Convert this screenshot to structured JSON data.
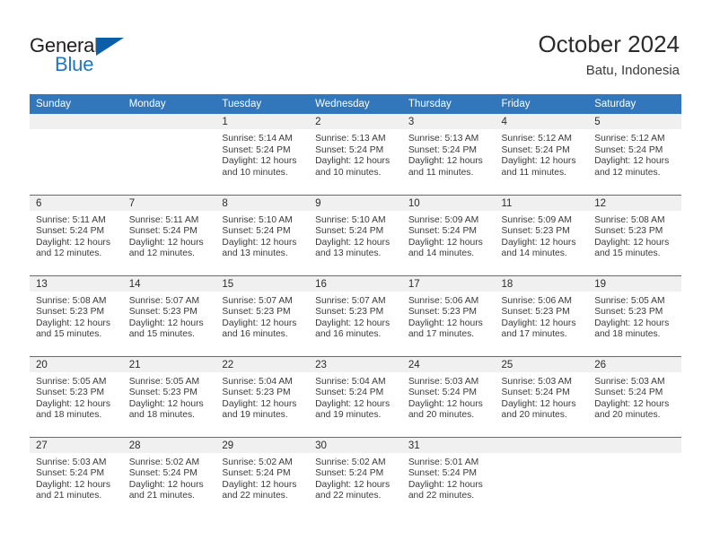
{
  "brand": {
    "name_part1": "General",
    "name_part2": "Blue",
    "triangle_color": "#0a5fa8",
    "blue_color": "#1f76c2"
  },
  "header": {
    "title": "October 2024",
    "subtitle": "Batu, Indonesia"
  },
  "theme": {
    "header_bg": "#3277bc",
    "daynum_bg": "#f0f0f0",
    "grid_line": "#3277bc",
    "text": "#3a3a3a"
  },
  "weekday_headers": [
    "Sunday",
    "Monday",
    "Tuesday",
    "Wednesday",
    "Thursday",
    "Friday",
    "Saturday"
  ],
  "weeks": [
    [
      {
        "day": "",
        "empty": true,
        "sunrise": "",
        "sunset": "",
        "daylight_1": "",
        "daylight_2": ""
      },
      {
        "day": "",
        "empty": true,
        "sunrise": "",
        "sunset": "",
        "daylight_1": "",
        "daylight_2": ""
      },
      {
        "day": "1",
        "empty": false,
        "sunrise": "Sunrise: 5:14 AM",
        "sunset": "Sunset: 5:24 PM",
        "daylight_1": "Daylight: 12 hours",
        "daylight_2": "and 10 minutes."
      },
      {
        "day": "2",
        "empty": false,
        "sunrise": "Sunrise: 5:13 AM",
        "sunset": "Sunset: 5:24 PM",
        "daylight_1": "Daylight: 12 hours",
        "daylight_2": "and 10 minutes."
      },
      {
        "day": "3",
        "empty": false,
        "sunrise": "Sunrise: 5:13 AM",
        "sunset": "Sunset: 5:24 PM",
        "daylight_1": "Daylight: 12 hours",
        "daylight_2": "and 11 minutes."
      },
      {
        "day": "4",
        "empty": false,
        "sunrise": "Sunrise: 5:12 AM",
        "sunset": "Sunset: 5:24 PM",
        "daylight_1": "Daylight: 12 hours",
        "daylight_2": "and 11 minutes."
      },
      {
        "day": "5",
        "empty": false,
        "sunrise": "Sunrise: 5:12 AM",
        "sunset": "Sunset: 5:24 PM",
        "daylight_1": "Daylight: 12 hours",
        "daylight_2": "and 12 minutes."
      }
    ],
    [
      {
        "day": "6",
        "empty": false,
        "sunrise": "Sunrise: 5:11 AM",
        "sunset": "Sunset: 5:24 PM",
        "daylight_1": "Daylight: 12 hours",
        "daylight_2": "and 12 minutes."
      },
      {
        "day": "7",
        "empty": false,
        "sunrise": "Sunrise: 5:11 AM",
        "sunset": "Sunset: 5:24 PM",
        "daylight_1": "Daylight: 12 hours",
        "daylight_2": "and 12 minutes."
      },
      {
        "day": "8",
        "empty": false,
        "sunrise": "Sunrise: 5:10 AM",
        "sunset": "Sunset: 5:24 PM",
        "daylight_1": "Daylight: 12 hours",
        "daylight_2": "and 13 minutes."
      },
      {
        "day": "9",
        "empty": false,
        "sunrise": "Sunrise: 5:10 AM",
        "sunset": "Sunset: 5:24 PM",
        "daylight_1": "Daylight: 12 hours",
        "daylight_2": "and 13 minutes."
      },
      {
        "day": "10",
        "empty": false,
        "sunrise": "Sunrise: 5:09 AM",
        "sunset": "Sunset: 5:24 PM",
        "daylight_1": "Daylight: 12 hours",
        "daylight_2": "and 14 minutes."
      },
      {
        "day": "11",
        "empty": false,
        "sunrise": "Sunrise: 5:09 AM",
        "sunset": "Sunset: 5:23 PM",
        "daylight_1": "Daylight: 12 hours",
        "daylight_2": "and 14 minutes."
      },
      {
        "day": "12",
        "empty": false,
        "sunrise": "Sunrise: 5:08 AM",
        "sunset": "Sunset: 5:23 PM",
        "daylight_1": "Daylight: 12 hours",
        "daylight_2": "and 15 minutes."
      }
    ],
    [
      {
        "day": "13",
        "empty": false,
        "sunrise": "Sunrise: 5:08 AM",
        "sunset": "Sunset: 5:23 PM",
        "daylight_1": "Daylight: 12 hours",
        "daylight_2": "and 15 minutes."
      },
      {
        "day": "14",
        "empty": false,
        "sunrise": "Sunrise: 5:07 AM",
        "sunset": "Sunset: 5:23 PM",
        "daylight_1": "Daylight: 12 hours",
        "daylight_2": "and 15 minutes."
      },
      {
        "day": "15",
        "empty": false,
        "sunrise": "Sunrise: 5:07 AM",
        "sunset": "Sunset: 5:23 PM",
        "daylight_1": "Daylight: 12 hours",
        "daylight_2": "and 16 minutes."
      },
      {
        "day": "16",
        "empty": false,
        "sunrise": "Sunrise: 5:07 AM",
        "sunset": "Sunset: 5:23 PM",
        "daylight_1": "Daylight: 12 hours",
        "daylight_2": "and 16 minutes."
      },
      {
        "day": "17",
        "empty": false,
        "sunrise": "Sunrise: 5:06 AM",
        "sunset": "Sunset: 5:23 PM",
        "daylight_1": "Daylight: 12 hours",
        "daylight_2": "and 17 minutes."
      },
      {
        "day": "18",
        "empty": false,
        "sunrise": "Sunrise: 5:06 AM",
        "sunset": "Sunset: 5:23 PM",
        "daylight_1": "Daylight: 12 hours",
        "daylight_2": "and 17 minutes."
      },
      {
        "day": "19",
        "empty": false,
        "sunrise": "Sunrise: 5:05 AM",
        "sunset": "Sunset: 5:23 PM",
        "daylight_1": "Daylight: 12 hours",
        "daylight_2": "and 18 minutes."
      }
    ],
    [
      {
        "day": "20",
        "empty": false,
        "sunrise": "Sunrise: 5:05 AM",
        "sunset": "Sunset: 5:23 PM",
        "daylight_1": "Daylight: 12 hours",
        "daylight_2": "and 18 minutes."
      },
      {
        "day": "21",
        "empty": false,
        "sunrise": "Sunrise: 5:05 AM",
        "sunset": "Sunset: 5:23 PM",
        "daylight_1": "Daylight: 12 hours",
        "daylight_2": "and 18 minutes."
      },
      {
        "day": "22",
        "empty": false,
        "sunrise": "Sunrise: 5:04 AM",
        "sunset": "Sunset: 5:23 PM",
        "daylight_1": "Daylight: 12 hours",
        "daylight_2": "and 19 minutes."
      },
      {
        "day": "23",
        "empty": false,
        "sunrise": "Sunrise: 5:04 AM",
        "sunset": "Sunset: 5:24 PM",
        "daylight_1": "Daylight: 12 hours",
        "daylight_2": "and 19 minutes."
      },
      {
        "day": "24",
        "empty": false,
        "sunrise": "Sunrise: 5:03 AM",
        "sunset": "Sunset: 5:24 PM",
        "daylight_1": "Daylight: 12 hours",
        "daylight_2": "and 20 minutes."
      },
      {
        "day": "25",
        "empty": false,
        "sunrise": "Sunrise: 5:03 AM",
        "sunset": "Sunset: 5:24 PM",
        "daylight_1": "Daylight: 12 hours",
        "daylight_2": "and 20 minutes."
      },
      {
        "day": "26",
        "empty": false,
        "sunrise": "Sunrise: 5:03 AM",
        "sunset": "Sunset: 5:24 PM",
        "daylight_1": "Daylight: 12 hours",
        "daylight_2": "and 20 minutes."
      }
    ],
    [
      {
        "day": "27",
        "empty": false,
        "sunrise": "Sunrise: 5:03 AM",
        "sunset": "Sunset: 5:24 PM",
        "daylight_1": "Daylight: 12 hours",
        "daylight_2": "and 21 minutes."
      },
      {
        "day": "28",
        "empty": false,
        "sunrise": "Sunrise: 5:02 AM",
        "sunset": "Sunset: 5:24 PM",
        "daylight_1": "Daylight: 12 hours",
        "daylight_2": "and 21 minutes."
      },
      {
        "day": "29",
        "empty": false,
        "sunrise": "Sunrise: 5:02 AM",
        "sunset": "Sunset: 5:24 PM",
        "daylight_1": "Daylight: 12 hours",
        "daylight_2": "and 22 minutes."
      },
      {
        "day": "30",
        "empty": false,
        "sunrise": "Sunrise: 5:02 AM",
        "sunset": "Sunset: 5:24 PM",
        "daylight_1": "Daylight: 12 hours",
        "daylight_2": "and 22 minutes."
      },
      {
        "day": "31",
        "empty": false,
        "sunrise": "Sunrise: 5:01 AM",
        "sunset": "Sunset: 5:24 PM",
        "daylight_1": "Daylight: 12 hours",
        "daylight_2": "and 22 minutes."
      },
      {
        "day": "",
        "empty": true,
        "sunrise": "",
        "sunset": "",
        "daylight_1": "",
        "daylight_2": ""
      },
      {
        "day": "",
        "empty": true,
        "sunrise": "",
        "sunset": "",
        "daylight_1": "",
        "daylight_2": ""
      }
    ]
  ]
}
